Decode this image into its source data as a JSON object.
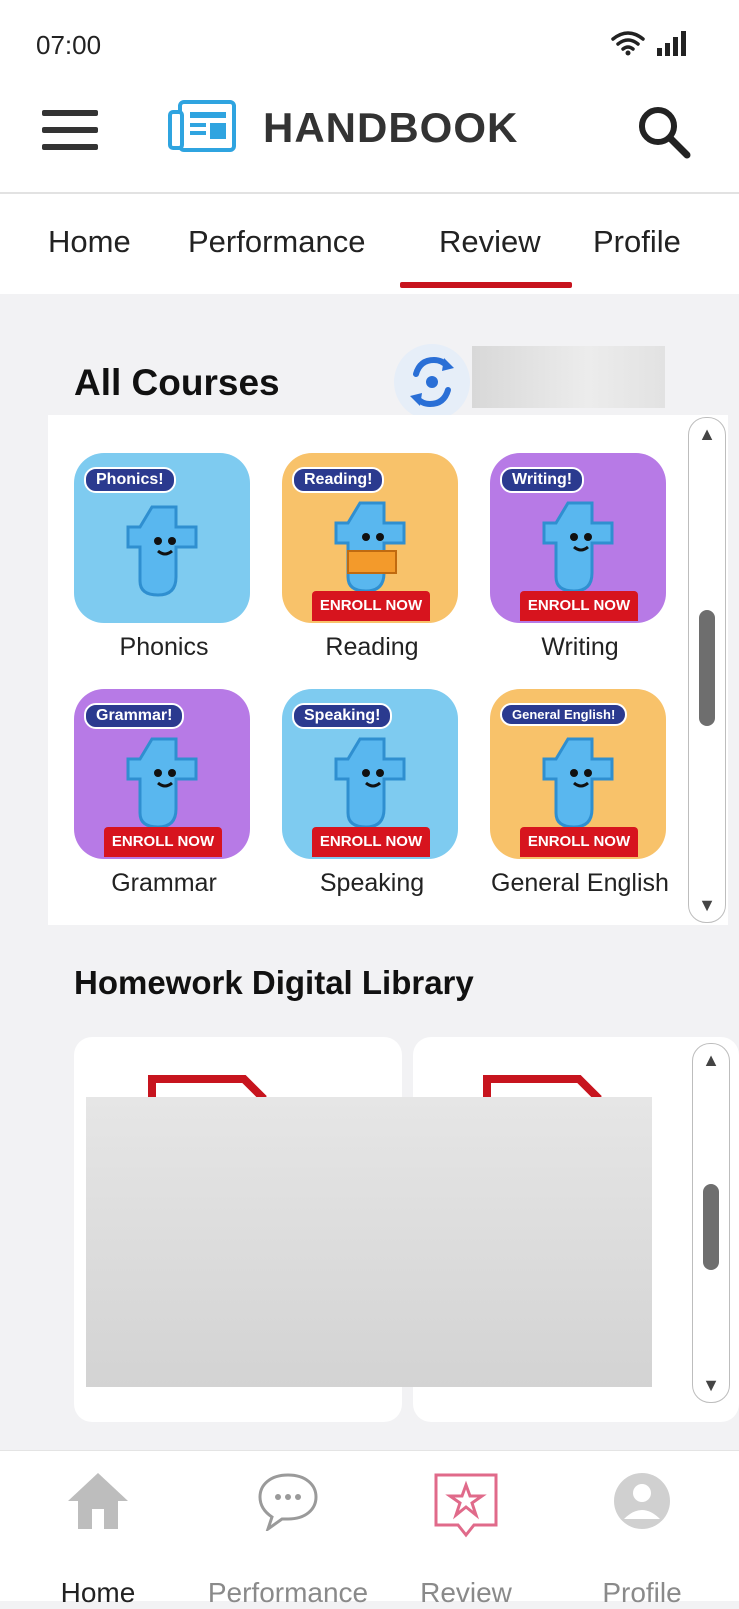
{
  "status": {
    "time": "07:00"
  },
  "app": {
    "title": "HANDBOOK"
  },
  "tabs": [
    {
      "label": "Home"
    },
    {
      "label": "Performance"
    },
    {
      "label": "Review",
      "active": true
    },
    {
      "label": "Profile"
    }
  ],
  "courses": {
    "title": "All Courses",
    "items": [
      {
        "label": "Phonics",
        "badge": "Phonics!",
        "color": "#7ecbf0",
        "enroll": ""
      },
      {
        "label": "Reading",
        "badge": "Reading!",
        "color": "#f8c26a",
        "enroll": "ENROLL NOW"
      },
      {
        "label": "Writing",
        "badge": "Writing!",
        "color": "#b77ae6",
        "enroll": "ENROLL NOW"
      },
      {
        "label": "Grammar",
        "badge": "Grammar!",
        "color": "#b77ae6",
        "enroll": "ENROLL NOW"
      },
      {
        "label": "Speaking",
        "badge": "Speaking!",
        "color": "#7ecbf0",
        "enroll": "ENROLL NOW"
      },
      {
        "label": "General English",
        "badge": "General English!",
        "color": "#f8c26a",
        "enroll": "ENROLL NOW"
      }
    ]
  },
  "homework": {
    "title": "Homework Digital Library"
  },
  "bottom_nav": [
    {
      "label": "Home",
      "icon": "home-icon",
      "active": true
    },
    {
      "label": "Performance",
      "icon": "chat-bubble-icon"
    },
    {
      "label": "Review",
      "icon": "star-bubble-icon"
    },
    {
      "label": "Profile",
      "icon": "user-icon"
    }
  ],
  "colors": {
    "accent": "#c7141e",
    "logo_blue": "#2fa4e0",
    "active_review_pink": "#e06a8a"
  }
}
